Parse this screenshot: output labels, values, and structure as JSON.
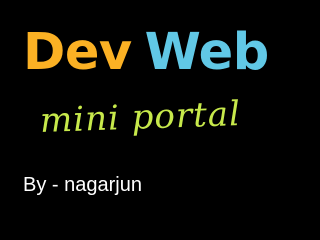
{
  "banner": {
    "background": "#000000",
    "title": {
      "word1": "Dev",
      "word2": "Web",
      "word1_color": "#fbb124",
      "word2_color": "#61c8e6"
    },
    "subtitle": {
      "text": "mini portal",
      "color": "#c7e94b"
    },
    "byline": {
      "text": "By - nagarjun",
      "color": "#ffffff"
    }
  }
}
